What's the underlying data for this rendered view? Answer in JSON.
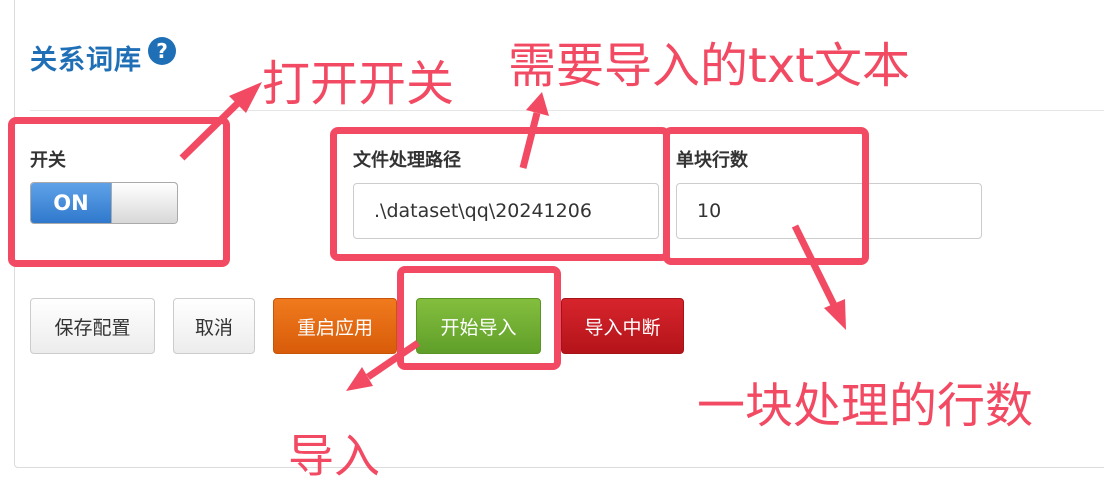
{
  "header": {
    "title": "关系词库",
    "help_icon": "help-icon"
  },
  "form": {
    "switch_label": "开关",
    "switch_state": "ON",
    "path_label": "文件处理路径",
    "path_value": ".\\dataset\\qq\\20241206",
    "rows_label": "单块行数",
    "rows_value": "10"
  },
  "buttons": {
    "save": "保存配置",
    "cancel": "取消",
    "restart": "重启应用",
    "start_import": "开始导入",
    "interrupt": "导入中断"
  },
  "annotations": {
    "switch_note": "打开开关",
    "file_note": "需要导入的txt文本",
    "rows_note": "一块处理的行数",
    "import_note": "导入",
    "color": "#f24a63"
  }
}
